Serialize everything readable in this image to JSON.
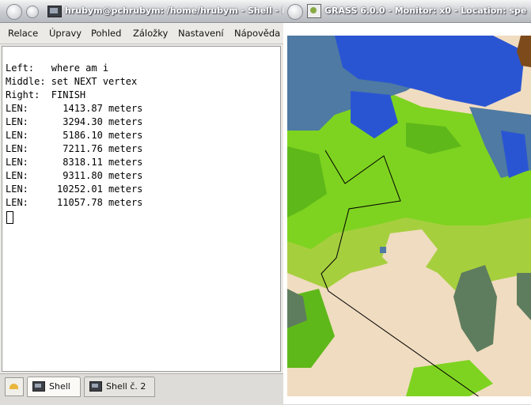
{
  "konsole": {
    "title": "hrubym@pchrubym: /home/hrubym - Shell - Kor",
    "menu": [
      "Relace",
      "Úpravy",
      "Pohled",
      "Záložky",
      "Nastavení",
      "Nápověda"
    ],
    "terminal_lines": [
      "Left:   where am i",
      "Middle: set NEXT vertex",
      "Right:  FINISH",
      "LEN:      1413.87 meters",
      "LEN:      3294.30 meters",
      "LEN:      5186.10 meters",
      "LEN:      7211.76 meters",
      "LEN:      8318.11 meters",
      "LEN:      9311.80 meters",
      "LEN:     10252.01 meters",
      "LEN:     11057.78 meters"
    ],
    "tabs": [
      "Shell",
      "Shell č. 2"
    ]
  },
  "grass": {
    "title": "GRASS 6.0.0 - Monitor: x0 - Location: spe"
  },
  "colors": {
    "water_dark": "#2a55d2",
    "water_steel": "#4e7aa3",
    "grass_bright": "#7ed320",
    "grass_mid": "#5fb81a",
    "meadow": "#a6cf3e",
    "field_light": "#f0dcc0",
    "forest_dark": "#5e7d5e",
    "brown": "#7d4a1c",
    "measure_line": "#000000"
  }
}
